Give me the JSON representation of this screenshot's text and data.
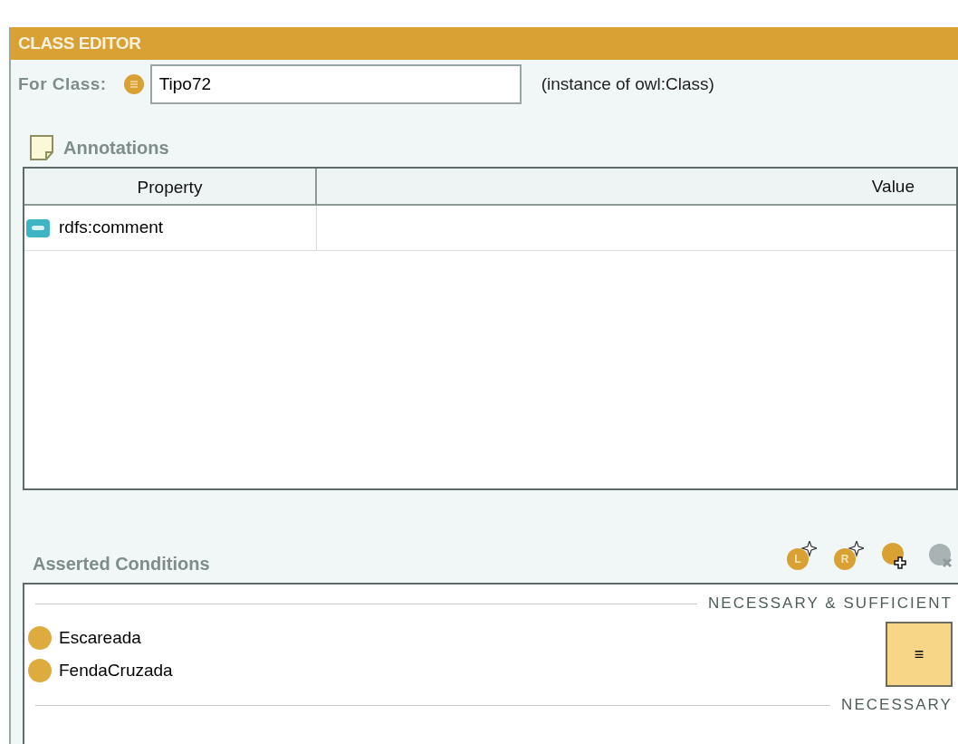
{
  "panel": {
    "title": "CLASS EDITOR"
  },
  "for_class": {
    "label": "For Class:",
    "value": "Tipo72",
    "type_note": "(instance of owl:Class)"
  },
  "annotations": {
    "title": "Annotations",
    "columns": [
      "Property",
      "Value"
    ],
    "rows": [
      {
        "property": "rdfs:comment"
      }
    ]
  },
  "asserted_conditions": {
    "title": "Asserted Conditions",
    "toolbar": [
      {
        "kind": "letter",
        "label": "L",
        "disabled": false
      },
      {
        "kind": "letter",
        "label": "R",
        "disabled": false
      },
      {
        "kind": "add",
        "disabled": false
      },
      {
        "kind": "delete",
        "disabled": true
      }
    ],
    "sections": [
      {
        "heading": "NECESSARY & SUFFICIENT",
        "badge": "≡",
        "items": [
          {
            "label": "Escareada"
          },
          {
            "label": "FendaCruzada"
          }
        ]
      },
      {
        "heading": "NECESSARY"
      }
    ]
  }
}
